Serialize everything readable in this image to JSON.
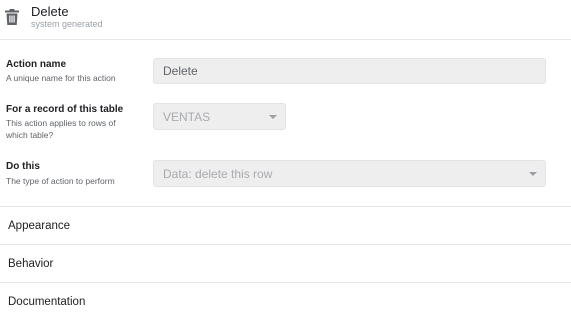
{
  "header": {
    "title": "Delete",
    "subtitle": "system generated",
    "icon": "trash-icon"
  },
  "fields": {
    "action_name": {
      "label": "Action name",
      "help": "A unique name for this action",
      "value": "Delete"
    },
    "record_table": {
      "label": "For a record of this table",
      "help_line1": "This action applies to rows of",
      "help_line2": "which table?",
      "value": "VENTAS"
    },
    "do_this": {
      "label": "Do this",
      "help": "The type of action to perform",
      "value": "Data: delete this row"
    }
  },
  "sections": {
    "appearance": "Appearance",
    "behavior": "Behavior",
    "documentation": "Documentation"
  },
  "colors": {
    "field_bg": "#eeeeee",
    "muted_text": "#9aa0a6",
    "divider": "#e6e6e6"
  }
}
